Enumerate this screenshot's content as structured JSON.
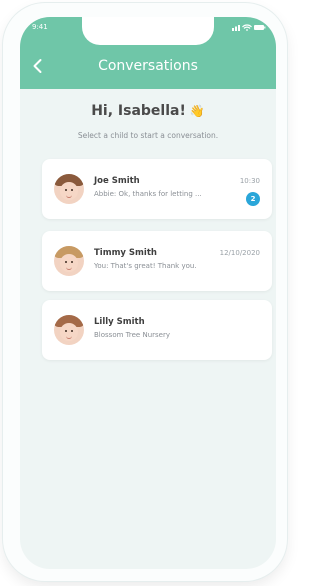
{
  "status_bar": {
    "time": "9:41"
  },
  "header": {
    "title": "Conversations"
  },
  "greeting": {
    "text": "Hi, Isabella!",
    "emoji": "👋"
  },
  "subtitle": "Select a child to start a conversation.",
  "conversations": [
    {
      "name": "Joe Smith",
      "preview": "Abbie: Ok, thanks for letting ...",
      "time": "10:30",
      "unread": "2"
    },
    {
      "name": "Timmy Smith",
      "preview": "You: That's great! Thank you.",
      "time": "12/10/2020"
    },
    {
      "name": "Lilly Smith",
      "preview": "Blossom Tree Nursery"
    }
  ],
  "colors": {
    "header": "#6fc6a8",
    "background": "#eef5f4",
    "badge": "#2aa6d9"
  }
}
